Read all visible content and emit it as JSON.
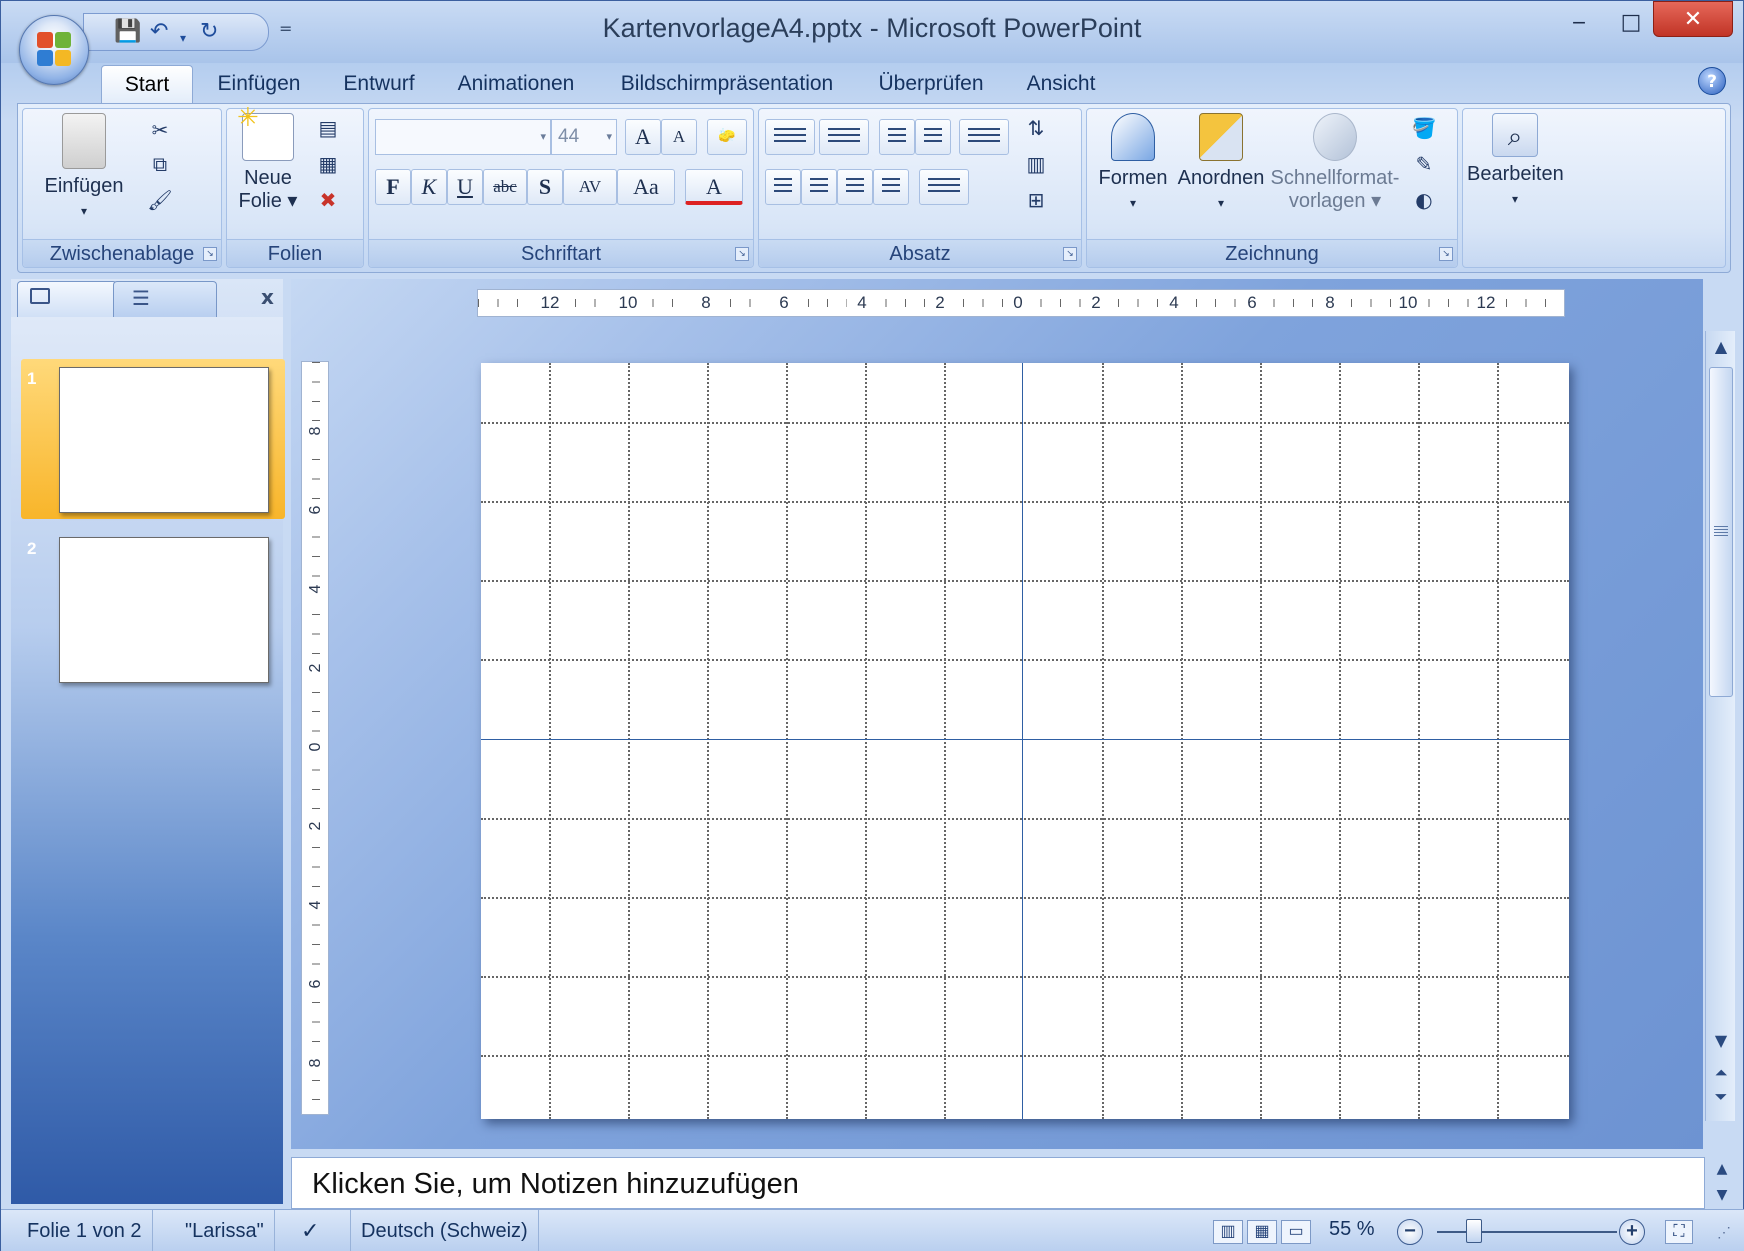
{
  "window": {
    "title": "KartenvorlageA4.pptx - Microsoft PowerPoint",
    "minimize": "‒",
    "maximize": "□",
    "close": "✕"
  },
  "qat": {
    "save": "💾",
    "undo": "↶",
    "redo": "↻",
    "more": "="
  },
  "tabs": [
    {
      "label": "Start",
      "active": true
    },
    {
      "label": "Einfügen"
    },
    {
      "label": "Entwurf"
    },
    {
      "label": "Animationen"
    },
    {
      "label": "Bildschirmpräsentation"
    },
    {
      "label": "Überprüfen"
    },
    {
      "label": "Ansicht"
    }
  ],
  "help": "?",
  "ribbon": {
    "clipboard": {
      "label": "Zwischenablage",
      "paste": "Einfügen"
    },
    "slides": {
      "label": "Folien",
      "new_slide_line1": "Neue",
      "new_slide_line2": "Folie ▾"
    },
    "font": {
      "label": "Schriftart",
      "font_size": "44",
      "bold": "F",
      "italic": "K",
      "underline": "U",
      "strike": "abc",
      "shadow": "S",
      "spacing": "AV",
      "case": "Aa",
      "color": "A",
      "grow": "A",
      "shrink": "A"
    },
    "paragraph": {
      "label": "Absatz"
    },
    "drawing": {
      "label": "Zeichnung",
      "shapes": "Formen",
      "arrange": "Anordnen",
      "quickstyles_line1": "Schnellformat-",
      "quickstyles_line2": "vorlagen ▾"
    },
    "editing": {
      "label": "Bearbeiten"
    }
  },
  "slides_panel": {
    "close": "x",
    "slides": [
      {
        "num": "1",
        "selected": true
      },
      {
        "num": "2"
      }
    ]
  },
  "ruler_h": [
    "12",
    "10",
    "8",
    "6",
    "4",
    "2",
    "0",
    "2",
    "4",
    "6",
    "8",
    "10",
    "12"
  ],
  "ruler_v": [
    "8",
    "6",
    "4",
    "2",
    "0",
    "2",
    "4",
    "6",
    "8"
  ],
  "notes": {
    "placeholder": "Klicken Sie, um Notizen hinzuzufügen"
  },
  "status": {
    "slide": "Folie 1 von 2",
    "theme": "\"Larissa\"",
    "language": "Deutsch (Schweiz)",
    "zoom": "55 %",
    "zoom_out": "−",
    "zoom_in": "+"
  },
  "colors": {
    "accent": "#2f5fa3",
    "close_btn": "#c13426",
    "selected_thumb": "#f8b52a"
  }
}
